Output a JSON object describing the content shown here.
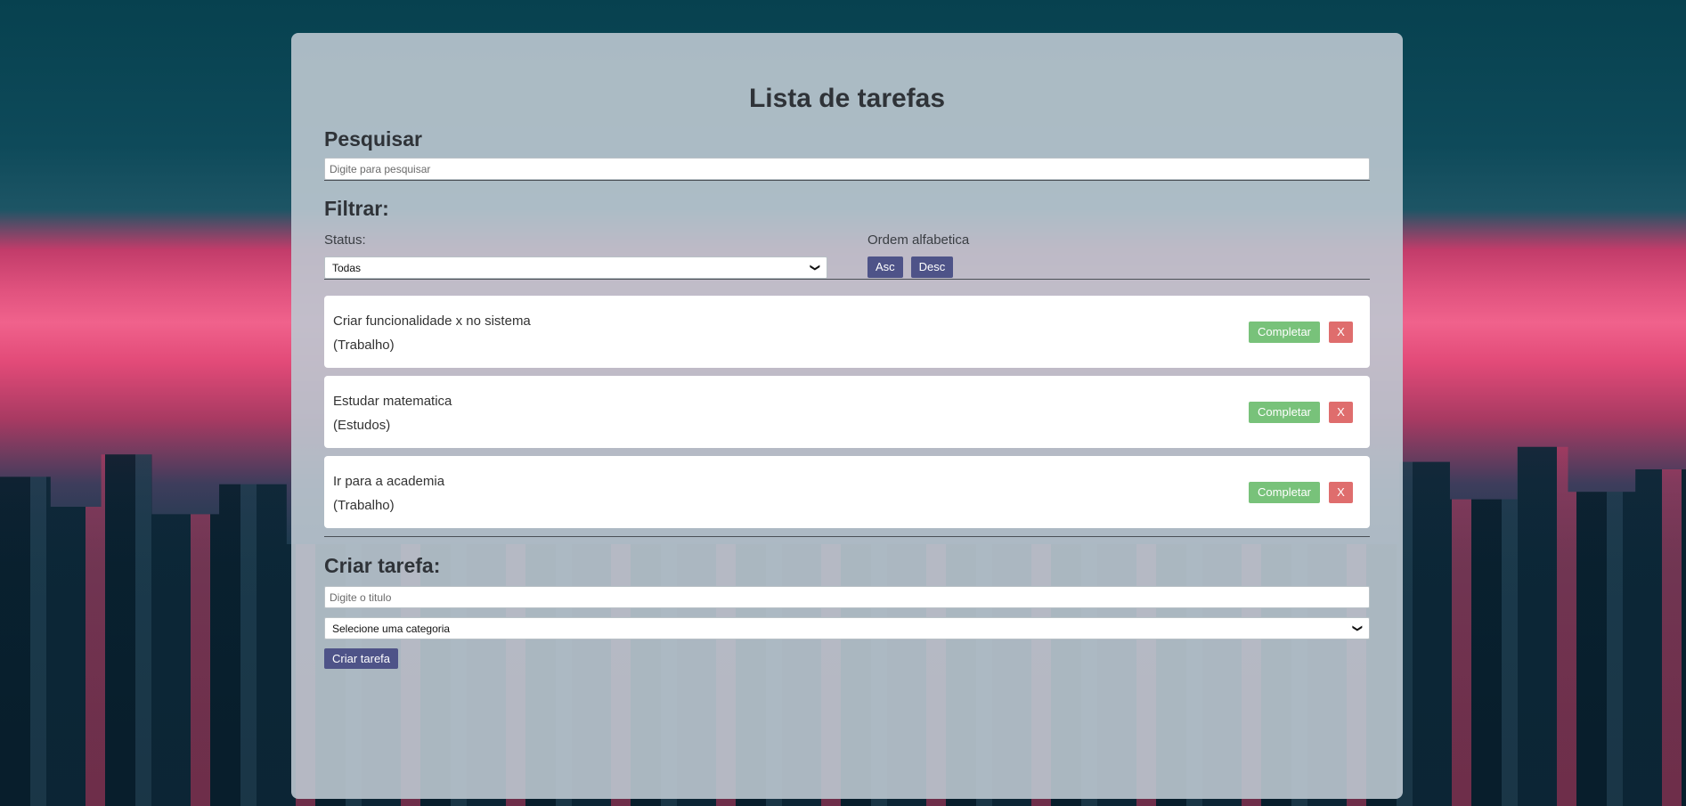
{
  "app": {
    "title": "Lista de tarefas"
  },
  "search": {
    "heading": "Pesquisar",
    "placeholder": "Digite para pesquisar",
    "value": ""
  },
  "filter": {
    "heading": "Filtrar:",
    "status_label": "Status:",
    "status_selected": "Todas",
    "order_label": "Ordem alfabetica",
    "asc_label": "Asc",
    "desc_label": "Desc"
  },
  "todos": [
    {
      "title": "Criar funcionalidade x no sistema",
      "category": "(Trabalho)",
      "complete_label": "Completar",
      "remove_label": "X"
    },
    {
      "title": "Estudar matematica",
      "category": "(Estudos)",
      "complete_label": "Completar",
      "remove_label": "X"
    },
    {
      "title": "Ir para a academia",
      "category": "(Trabalho)",
      "complete_label": "Completar",
      "remove_label": "X"
    }
  ],
  "create": {
    "heading": "Criar tarefa:",
    "title_placeholder": "Digite o titulo",
    "category_selected": "Selecione uma categoria",
    "submit_label": "Criar tarefa"
  },
  "colors": {
    "primary_button": "#4e5388",
    "complete_button": "#78c27a",
    "remove_button": "#df6d6d"
  }
}
